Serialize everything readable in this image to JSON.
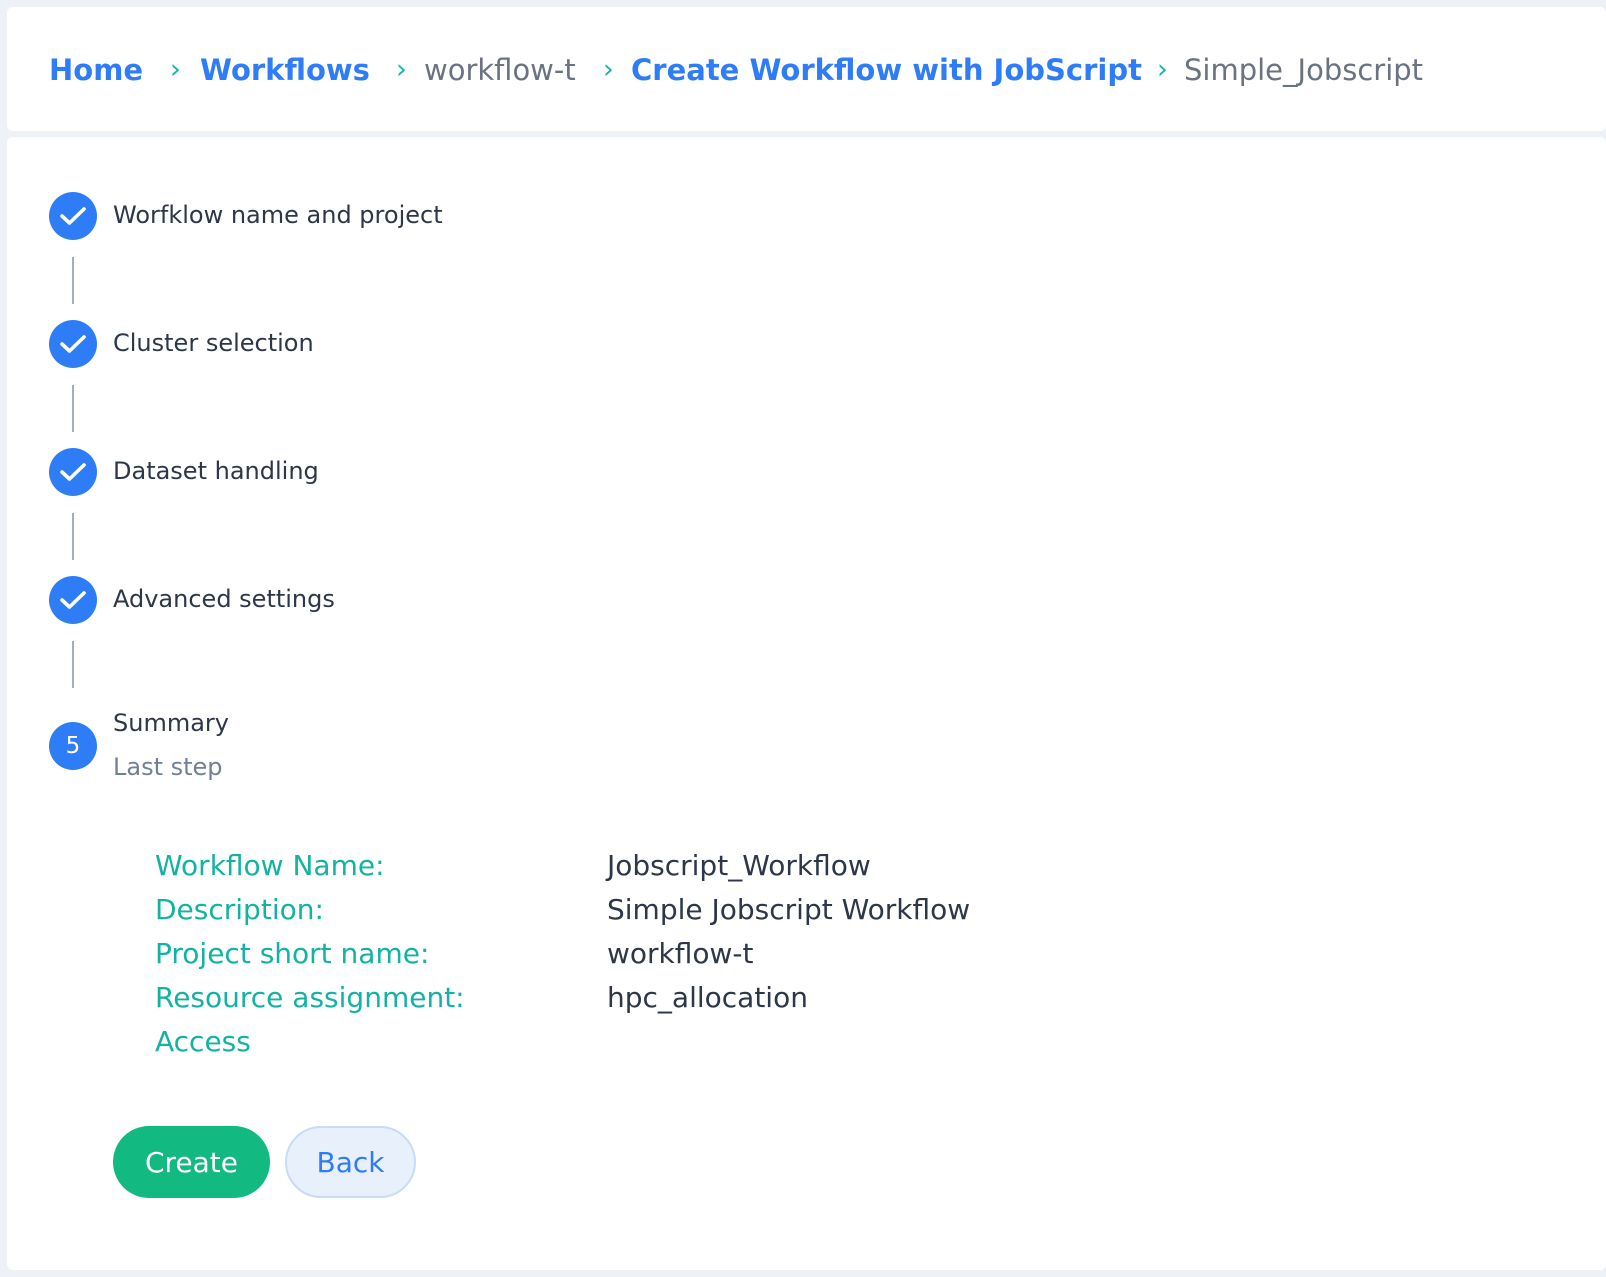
{
  "breadcrumb": [
    {
      "label": "Home",
      "link": true
    },
    {
      "label": "Workflows",
      "link": true
    },
    {
      "label": "workflow-t",
      "link": false
    },
    {
      "label": "Create Workflow with JobScript",
      "link": true
    },
    {
      "label": "Simple_Jobscript",
      "link": false
    }
  ],
  "breadcrumb_separator": "›",
  "steps": [
    {
      "label": "Worfklow name and project",
      "status": "done",
      "icon": "check-icon"
    },
    {
      "label": "Cluster selection",
      "status": "done",
      "icon": "check-icon"
    },
    {
      "label": "Dataset handling",
      "status": "done",
      "icon": "check-icon"
    },
    {
      "label": "Advanced settings",
      "status": "done",
      "icon": "check-icon"
    },
    {
      "label": "Summary",
      "number": "5",
      "sublabel": "Last step",
      "status": "active"
    }
  ],
  "summary": [
    {
      "label": "Workflow Name:",
      "value": "Jobscript_Workflow"
    },
    {
      "label": "Description:",
      "value": "Simple Jobscript Workflow"
    },
    {
      "label": "Project short name:",
      "value": "workflow-t"
    },
    {
      "label": "Resource assignment:",
      "value": "hpc_allocation"
    },
    {
      "label": "Access",
      "value": ""
    }
  ],
  "actions": {
    "create_label": "Create",
    "back_label": "Back"
  },
  "colors": {
    "primary": "#2f7df6",
    "accent_teal": "#13b3a3",
    "create_green": "#12b981",
    "background": "#eef2f7"
  }
}
